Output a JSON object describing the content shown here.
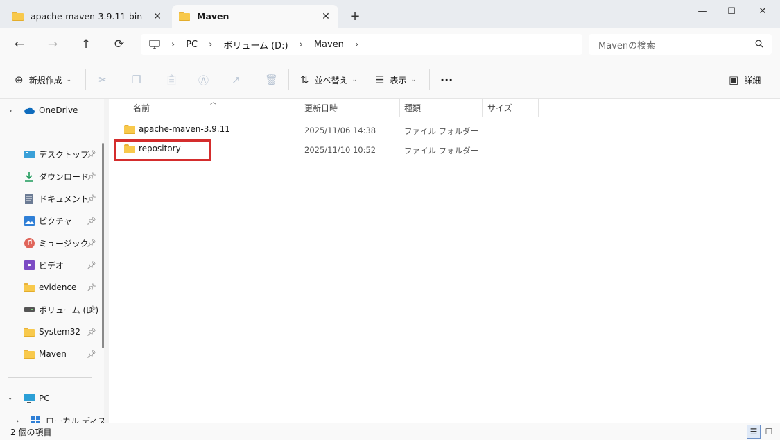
{
  "tabs": [
    {
      "label": "apache-maven-3.9.11-bin",
      "close": "✕"
    },
    {
      "label": "Maven",
      "close": "✕"
    }
  ],
  "new_tab": "+",
  "window": {
    "minimize": "—",
    "maximize": "☐",
    "close": "✕"
  },
  "nav": {
    "back": "←",
    "forward": "→",
    "up": "↑",
    "refresh": "⟳"
  },
  "address": {
    "crumbs": [
      "PC",
      "ボリューム (D:)",
      "Maven"
    ],
    "separator": "›"
  },
  "search": {
    "placeholder": "Mavenの検索"
  },
  "toolbar": {
    "new_label": "新規作成",
    "sort_label": "並べ替え",
    "view_label": "表示",
    "more_label": "···",
    "details_label": "詳細"
  },
  "sidebar": {
    "onedrive": "OneDrive",
    "items": [
      {
        "label": "デスクトップ",
        "icon": "desktop-icon"
      },
      {
        "label": "ダウンロード",
        "icon": "download-icon"
      },
      {
        "label": "ドキュメント",
        "icon": "documents-icon"
      },
      {
        "label": "ピクチャ",
        "icon": "pictures-icon"
      },
      {
        "label": "ミュージック",
        "icon": "music-icon"
      },
      {
        "label": "ビデオ",
        "icon": "videos-icon"
      },
      {
        "label": "evidence",
        "icon": "folder-icon"
      },
      {
        "label": "ボリューム (D:)",
        "icon": "drive-icon"
      },
      {
        "label": "System32",
        "icon": "folder-icon"
      },
      {
        "label": "Maven",
        "icon": "folder-icon"
      }
    ],
    "pc": "PC",
    "local_disk": "ローカル ディスク"
  },
  "columns": {
    "name": "名前",
    "date": "更新日時",
    "type": "種類",
    "size": "サイズ"
  },
  "files": [
    {
      "name": "apache-maven-3.9.11",
      "date": "2025/11/06 14:38",
      "type": "ファイル フォルダー"
    },
    {
      "name": "repository",
      "date": "2025/11/10 10:52",
      "type": "ファイル フォルダー"
    }
  ],
  "status": {
    "count": "2 個の項目"
  },
  "colors": {
    "highlight": "#d42d2d",
    "folder": "#f8c94c"
  }
}
